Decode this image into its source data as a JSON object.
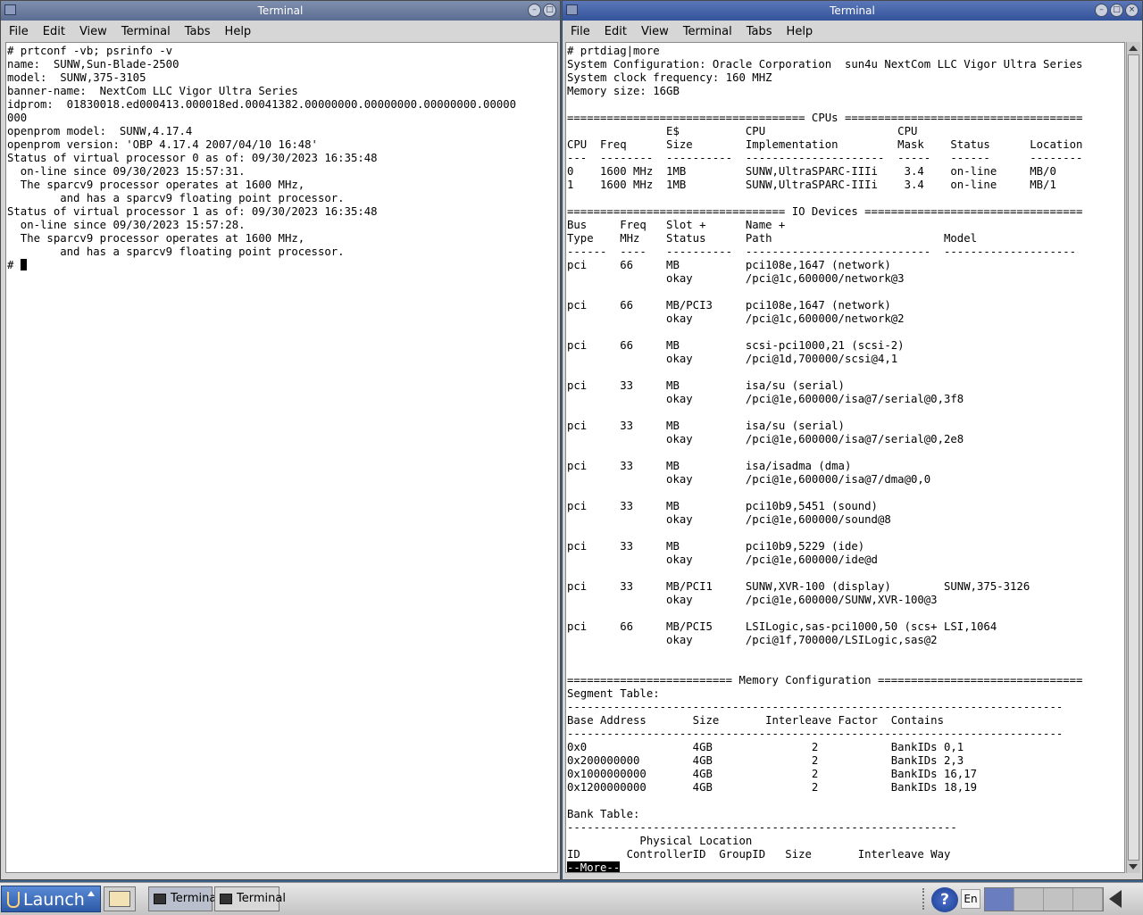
{
  "left_window": {
    "title": "Terminal",
    "menu": [
      "File",
      "Edit",
      "View",
      "Terminal",
      "Tabs",
      "Help"
    ],
    "content": "# prtconf -vb; psrinfo -v\nname:  SUNW,Sun-Blade-2500\nmodel:  SUNW,375-3105\nbanner-name:  NextCom LLC Vigor Ultra Series\nidprom:  01830018.ed000413.000018ed.00041382.00000000.00000000.00000000.00000\n000\nopenprom model:  SUNW,4.17.4\nopenprom version: 'OBP 4.17.4 2007/04/10 16:48'\nStatus of virtual processor 0 as of: 09/30/2023 16:35:48\n  on-line since 09/30/2023 15:57:31.\n  The sparcv9 processor operates at 1600 MHz,\n        and has a sparcv9 floating point processor.\nStatus of virtual processor 1 as of: 09/30/2023 16:35:48\n  on-line since 09/30/2023 15:57:28.\n  The sparcv9 processor operates at 1600 MHz,\n        and has a sparcv9 floating point processor.\n",
    "prompt": "# "
  },
  "right_window": {
    "title": "Terminal",
    "menu": [
      "File",
      "Edit",
      "View",
      "Terminal",
      "Tabs",
      "Help"
    ],
    "content": "# prtdiag|more\nSystem Configuration: Oracle Corporation  sun4u NextCom LLC Vigor Ultra Series\nSystem clock frequency: 160 MHZ\nMemory size: 16GB\n\n==================================== CPUs ====================================\n               E$          CPU                    CPU\nCPU  Freq      Size        Implementation         Mask    Status      Location\n---  --------  ----------  ---------------------  -----   ------      --------\n0    1600 MHz  1MB         SUNW,UltraSPARC-IIIi    3.4    on-line     MB/0\n1    1600 MHz  1MB         SUNW,UltraSPARC-IIIi    3.4    on-line     MB/1\n\n================================= IO Devices =================================\nBus     Freq   Slot +      Name +\nType    MHz    Status      Path                          Model\n------  ----   ----------  ----------------------------  --------------------\npci     66     MB          pci108e,1647 (network)\n               okay        /pci@1c,600000/network@3\n\npci     66     MB/PCI3     pci108e,1647 (network)\n               okay        /pci@1c,600000/network@2\n\npci     66     MB          scsi-pci1000,21 (scsi-2)\n               okay        /pci@1d,700000/scsi@4,1\n\npci     33     MB          isa/su (serial)\n               okay        /pci@1e,600000/isa@7/serial@0,3f8\n\npci     33     MB          isa/su (serial)\n               okay        /pci@1e,600000/isa@7/serial@0,2e8\n\npci     33     MB          isa/isadma (dma)\n               okay        /pci@1e,600000/isa@7/dma@0,0\n\npci     33     MB          pci10b9,5451 (sound)\n               okay        /pci@1e,600000/sound@8\n\npci     33     MB          pci10b9,5229 (ide)\n               okay        /pci@1e,600000/ide@d\n\npci     33     MB/PCI1     SUNW,XVR-100 (display)        SUNW,375-3126\n               okay        /pci@1e,600000/SUNW,XVR-100@3\n\npci     66     MB/PCI5     LSILogic,sas-pci1000,50 (scs+ LSI,1064\n               okay        /pci@1f,700000/LSILogic,sas@2\n\n\n========================= Memory Configuration ===============================\nSegment Table:\n---------------------------------------------------------------------------\nBase Address       Size       Interleave Factor  Contains\n---------------------------------------------------------------------------\n0x0                4GB               2           BankIDs 0,1\n0x200000000        4GB               2           BankIDs 2,3\n0x1000000000       4GB               2           BankIDs 16,17\n0x1200000000       4GB               2           BankIDs 18,19\n\nBank Table:\n-----------------------------------------------------------\n           Physical Location\nID       ControllerID  GroupID   Size       Interleave Way\n",
    "more_prompt": "--More--"
  },
  "taskbar": {
    "launch_label": "Launch",
    "tasks": [
      "Terminal",
      "Terminal"
    ],
    "help_label": "?",
    "lang": "En"
  }
}
